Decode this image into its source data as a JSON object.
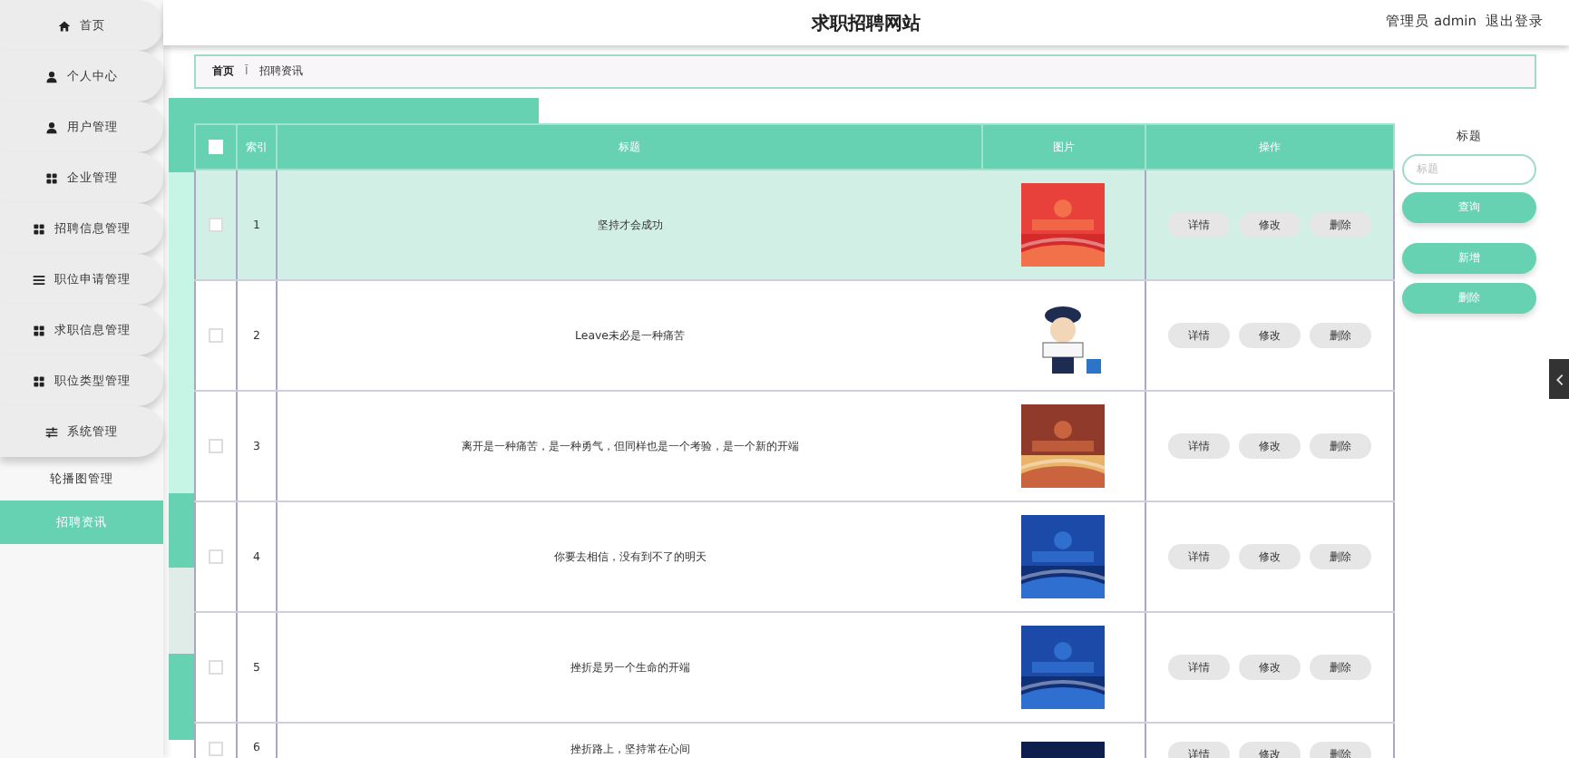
{
  "sidebar": {
    "items": [
      {
        "label": "首页",
        "kind": "card",
        "selected": false
      },
      {
        "label": "个人中心",
        "kind": "card",
        "selected": false
      },
      {
        "label": "用户管理",
        "kind": "card",
        "selected": false
      },
      {
        "label": "企业管理",
        "kind": "card",
        "selected": false
      },
      {
        "label": "招聘信息管理",
        "kind": "card",
        "selected": false
      },
      {
        "label": "职位申请管理",
        "kind": "card",
        "selected": false
      },
      {
        "label": "求职信息管理",
        "kind": "card",
        "selected": false
      },
      {
        "label": "职位类型管理",
        "kind": "card",
        "selected": false
      },
      {
        "label": "系统管理",
        "kind": "card",
        "selected": false
      },
      {
        "label": "轮播图管理",
        "kind": "flat",
        "selected": false
      },
      {
        "label": "招聘资讯",
        "kind": "flat",
        "selected": true
      }
    ]
  },
  "header": {
    "title": "求职招聘网站",
    "user": "管理员 admin",
    "logout": "退出登录"
  },
  "breadcrumb": {
    "home": "首页",
    "separator": "Ī",
    "current": "招聘资讯"
  },
  "table": {
    "columns": [
      "索引",
      "标题",
      "图片",
      "操作"
    ],
    "all_checked": false,
    "rows": [
      {
        "index": "1",
        "title": "坚持才会成功",
        "image": {
          "kind": "picture"
        },
        "checked": false,
        "selected": true,
        "actions": [
          "详情",
          "修改",
          "删除"
        ]
      },
      {
        "index": "2",
        "title": "Leave未必是一种痛苦",
        "image": {
          "kind": "picture"
        },
        "checked": false,
        "selected": false,
        "actions": [
          "详情",
          "修改",
          "删除"
        ]
      },
      {
        "index": "3",
        "title": "离开是一种痛苦，是一种勇气，但同样也是一个考验，是一个新的开端",
        "image": {
          "kind": "picture"
        },
        "checked": false,
        "selected": false,
        "actions": [
          "详情",
          "修改",
          "删除"
        ]
      },
      {
        "index": "4",
        "title": "你要去相信，没有到不了的明天",
        "image": {
          "kind": "picture"
        },
        "checked": false,
        "selected": false,
        "actions": [
          "详情",
          "修改",
          "删除"
        ]
      },
      {
        "index": "5",
        "title": "挫折是另一个生命的开端",
        "image": {
          "kind": "picture"
        },
        "checked": false,
        "selected": false,
        "actions": [
          "详情",
          "修改",
          "删除"
        ]
      },
      {
        "index": "6",
        "title": "挫折路上，坚持常在心间",
        "image": {
          "kind": "picture"
        },
        "checked": false,
        "selected": false,
        "actions": [
          "详情",
          "修改",
          "删除"
        ]
      }
    ]
  },
  "search": {
    "label": "标题",
    "placeholder": "标题",
    "buttons": [
      "查询",
      "新增",
      "删除"
    ]
  }
}
